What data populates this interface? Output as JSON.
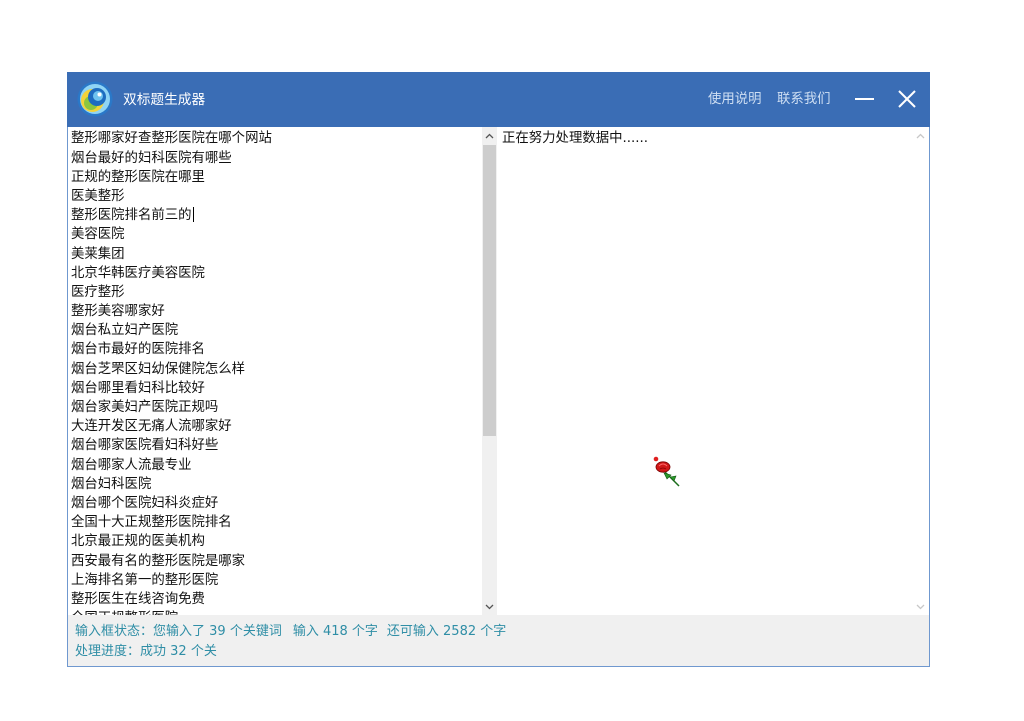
{
  "window": {
    "title": "双标题生成器",
    "logo_icon": "app-logo-icon"
  },
  "header": {
    "help_label": "使用说明",
    "contact_label": "联系我们",
    "minimize_icon": "minimize-icon",
    "close_icon": "close-icon"
  },
  "keyword_input": {
    "lines": [
      "整形哪家好查整形医院在哪个网站",
      "烟台最好的妇科医院有哪些",
      "正规的整形医院在哪里",
      "医美整形",
      "整形医院排名前三的",
      "美容医院",
      "美莱集团",
      "北京华韩医疗美容医院",
      "医疗整形",
      "整形美容哪家好",
      "烟台私立妇产医院",
      "烟台市最好的医院排名",
      "烟台芝罘区妇幼保健院怎么样",
      "烟台哪里看妇科比较好",
      "烟台家美妇产医院正规吗",
      "大连开发区无痛人流哪家好",
      "烟台哪家医院看妇科好些",
      "烟台哪家人流最专业",
      "烟台妇科医院",
      "烟台哪个医院妇科炎症好",
      "全国十大正规整形医院排名",
      "北京最正规的医美机构",
      "西安最有名的整形医院是哪家",
      "上海排名第一的整形医院",
      "整形医生在线咨询免费",
      "全国正规整形医院"
    ]
  },
  "output": {
    "message": "正在努力处理数据中......",
    "loading_icon": "rose-icon"
  },
  "status_bar": {
    "input_label": "输入框状态：",
    "keyword_count_text": "您输入了 39 个关键词",
    "char_count_text": "输入 418 个字",
    "remaining_text": "还可输入 2582 个字",
    "progress_label": "处理进度：",
    "progress_text": "成功 32 个关"
  },
  "colors": {
    "titlebar": "#3a6db5",
    "status_text": "#2f8ea6",
    "window_border": "#6f98cf",
    "status_background": "#f0f0f0"
  }
}
